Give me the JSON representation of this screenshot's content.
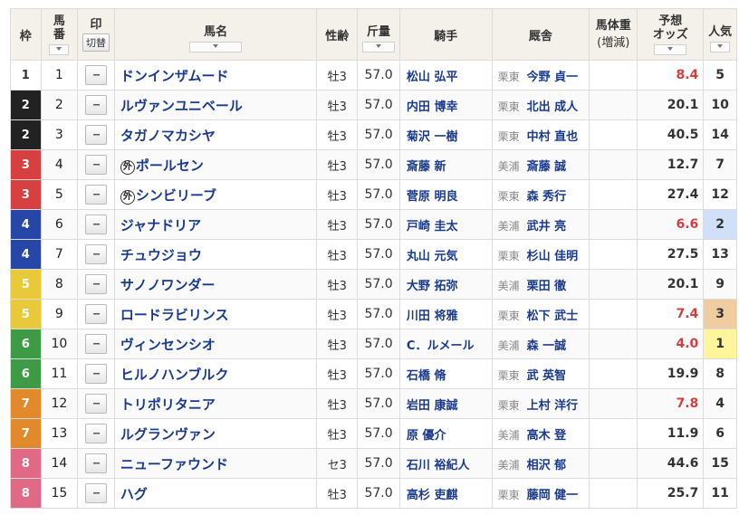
{
  "headers": {
    "waku": "枠",
    "umaban_1": "馬",
    "umaban_2": "番",
    "mark": "印",
    "mark_toggle": "切替",
    "horse": "馬名",
    "sex_age": "性齢",
    "weight": "斤量",
    "jockey": "騎手",
    "trainer": "厩舎",
    "body_weight_1": "馬体重",
    "body_weight_2": "(増減)",
    "odds_1": "予想",
    "odds_2": "オッズ",
    "popularity": "人気"
  },
  "mark_placeholder": "--",
  "foreign_badge": "外",
  "frame_colors": {
    "1": {
      "bg": "#ffffff",
      "fg": "#333333"
    },
    "2": {
      "bg": "#222222",
      "fg": "#ffffff"
    },
    "3": {
      "bg": "#d64040",
      "fg": "#ffffff"
    },
    "4": {
      "bg": "#2747a8",
      "fg": "#ffffff"
    },
    "5": {
      "bg": "#e8c93a",
      "fg": "#ffffff"
    },
    "6": {
      "bg": "#3f9a45",
      "fg": "#ffffff"
    },
    "7": {
      "bg": "#e08a2c",
      "fg": "#ffffff"
    },
    "8": {
      "bg": "#e06a86",
      "fg": "#ffffff"
    }
  },
  "popularity_highlight": {
    "1": "#fff59a",
    "2": "#cfe0f8",
    "3": "#f1cca0"
  },
  "rows": [
    {
      "waku": "1",
      "num": "1",
      "name": "ドンインザムード",
      "foreign": false,
      "sex": "牡3",
      "weight": "57.0",
      "jockey": "松山 弘平",
      "region": "栗東",
      "trainer": "今野 貞一",
      "odds": "8.4",
      "hot": true,
      "pop": "5"
    },
    {
      "waku": "2",
      "num": "2",
      "name": "ルヴァンユニベール",
      "foreign": false,
      "sex": "牡3",
      "weight": "57.0",
      "jockey": "内田 博幸",
      "region": "栗東",
      "trainer": "北出 成人",
      "odds": "20.1",
      "hot": false,
      "pop": "10"
    },
    {
      "waku": "2",
      "num": "3",
      "name": "タガノマカシヤ",
      "foreign": false,
      "sex": "牡3",
      "weight": "57.0",
      "jockey": "菊沢 一樹",
      "region": "栗東",
      "trainer": "中村 直也",
      "odds": "40.5",
      "hot": false,
      "pop": "14"
    },
    {
      "waku": "3",
      "num": "4",
      "name": "ポールセン",
      "foreign": true,
      "sex": "牡3",
      "weight": "57.0",
      "jockey": "斎藤 新",
      "region": "美浦",
      "trainer": "斎藤 誠",
      "odds": "12.7",
      "hot": false,
      "pop": "7"
    },
    {
      "waku": "3",
      "num": "5",
      "name": "シンビリーブ",
      "foreign": true,
      "sex": "牡3",
      "weight": "57.0",
      "jockey": "菅原 明良",
      "region": "栗東",
      "trainer": "森 秀行",
      "odds": "27.4",
      "hot": false,
      "pop": "12"
    },
    {
      "waku": "4",
      "num": "6",
      "name": "ジャナドリア",
      "foreign": false,
      "sex": "牡3",
      "weight": "57.0",
      "jockey": "戸崎 圭太",
      "region": "美浦",
      "trainer": "武井 亮",
      "odds": "6.6",
      "hot": true,
      "pop": "2"
    },
    {
      "waku": "4",
      "num": "7",
      "name": "チュウジョウ",
      "foreign": false,
      "sex": "牡3",
      "weight": "57.0",
      "jockey": "丸山 元気",
      "region": "栗東",
      "trainer": "杉山 佳明",
      "odds": "27.5",
      "hot": false,
      "pop": "13"
    },
    {
      "waku": "5",
      "num": "8",
      "name": "サノノワンダー",
      "foreign": false,
      "sex": "牡3",
      "weight": "57.0",
      "jockey": "大野 拓弥",
      "region": "美浦",
      "trainer": "栗田 徹",
      "odds": "20.1",
      "hot": false,
      "pop": "9"
    },
    {
      "waku": "5",
      "num": "9",
      "name": "ロードラビリンス",
      "foreign": false,
      "sex": "牡3",
      "weight": "57.0",
      "jockey": "川田 将雅",
      "region": "栗東",
      "trainer": "松下 武士",
      "odds": "7.4",
      "hot": true,
      "pop": "3"
    },
    {
      "waku": "6",
      "num": "10",
      "name": "ヴィンセンシオ",
      "foreign": false,
      "sex": "牡3",
      "weight": "57.0",
      "jockey": "C．ルメール",
      "region": "美浦",
      "trainer": "森 一誠",
      "odds": "4.0",
      "hot": true,
      "pop": "1"
    },
    {
      "waku": "6",
      "num": "11",
      "name": "ヒルノハンブルク",
      "foreign": false,
      "sex": "牡3",
      "weight": "57.0",
      "jockey": "石橋 脩",
      "region": "栗東",
      "trainer": "武 英智",
      "odds": "19.9",
      "hot": false,
      "pop": "8"
    },
    {
      "waku": "7",
      "num": "12",
      "name": "トリポリタニア",
      "foreign": false,
      "sex": "牡3",
      "weight": "57.0",
      "jockey": "岩田 康誠",
      "region": "栗東",
      "trainer": "上村 洋行",
      "odds": "7.8",
      "hot": true,
      "pop": "4"
    },
    {
      "waku": "7",
      "num": "13",
      "name": "ルグランヴァン",
      "foreign": false,
      "sex": "牡3",
      "weight": "57.0",
      "jockey": "原 優介",
      "region": "美浦",
      "trainer": "高木 登",
      "odds": "11.9",
      "hot": false,
      "pop": "6"
    },
    {
      "waku": "8",
      "num": "14",
      "name": "ニューファウンド",
      "foreign": false,
      "sex": "セ3",
      "weight": "57.0",
      "jockey": "石川 裕紀人",
      "region": "美浦",
      "trainer": "相沢 郁",
      "odds": "44.6",
      "hot": false,
      "pop": "15"
    },
    {
      "waku": "8",
      "num": "15",
      "name": "ハグ",
      "foreign": false,
      "sex": "牡3",
      "weight": "57.0",
      "jockey": "高杉 吏麒",
      "region": "栗東",
      "trainer": "藤岡 健一",
      "odds": "25.7",
      "hot": false,
      "pop": "11"
    }
  ]
}
